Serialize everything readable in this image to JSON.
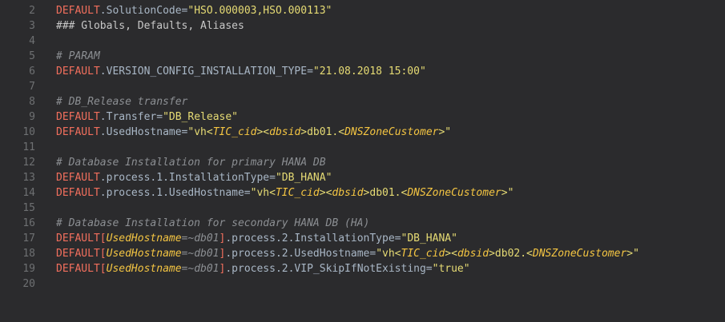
{
  "lines": [
    {
      "n": "2",
      "tokens": [
        {
          "t": "DEFAULT",
          "c": "default"
        },
        {
          "t": ".SolutionCode=",
          "c": "prop"
        },
        {
          "t": "\"HSO.000003,HSO.000113\"",
          "c": "string"
        }
      ]
    },
    {
      "n": "3",
      "tokens": [
        {
          "t": "### Globals, Defaults, Aliases",
          "c": "heading"
        }
      ]
    },
    {
      "n": "4",
      "tokens": []
    },
    {
      "n": "5",
      "tokens": [
        {
          "t": "# PARAM",
          "c": "comment"
        }
      ]
    },
    {
      "n": "6",
      "tokens": [
        {
          "t": "DEFAULT",
          "c": "default"
        },
        {
          "t": ".VERSION_CONFIG_INSTALLATION_TYPE=",
          "c": "prop"
        },
        {
          "t": "\"21.08.2018 15:00\"",
          "c": "string"
        }
      ]
    },
    {
      "n": "7",
      "tokens": []
    },
    {
      "n": "8",
      "tokens": [
        {
          "t": "# DB_Release transfer",
          "c": "comment"
        }
      ]
    },
    {
      "n": "9",
      "tokens": [
        {
          "t": "DEFAULT",
          "c": "default"
        },
        {
          "t": ".Transfer=",
          "c": "prop"
        },
        {
          "t": "\"DB_Release\"",
          "c": "string"
        }
      ]
    },
    {
      "n": "10",
      "tokens": [
        {
          "t": "DEFAULT",
          "c": "default"
        },
        {
          "t": ".UsedHostname=",
          "c": "prop"
        },
        {
          "t": "\"vh<",
          "c": "string"
        },
        {
          "t": "TIC_cid",
          "c": "var"
        },
        {
          "t": "><",
          "c": "string"
        },
        {
          "t": "dbsid",
          "c": "var"
        },
        {
          "t": ">db01.<",
          "c": "string"
        },
        {
          "t": "DNSZoneCustomer",
          "c": "var"
        },
        {
          "t": ">\"",
          "c": "string"
        }
      ]
    },
    {
      "n": "11",
      "tokens": []
    },
    {
      "n": "12",
      "tokens": [
        {
          "t": "# Database Installation for primary HANA DB",
          "c": "comment"
        }
      ]
    },
    {
      "n": "13",
      "tokens": [
        {
          "t": "DEFAULT",
          "c": "default"
        },
        {
          "t": ".process.1.InstallationType=",
          "c": "prop"
        },
        {
          "t": "\"DB_HANA\"",
          "c": "string"
        }
      ]
    },
    {
      "n": "14",
      "tokens": [
        {
          "t": "DEFAULT",
          "c": "default"
        },
        {
          "t": ".process.1.UsedHostname=",
          "c": "prop"
        },
        {
          "t": "\"vh<",
          "c": "string"
        },
        {
          "t": "TIC_cid",
          "c": "var"
        },
        {
          "t": "><",
          "c": "string"
        },
        {
          "t": "dbsid",
          "c": "var"
        },
        {
          "t": ">db01.<",
          "c": "string"
        },
        {
          "t": "DNSZoneCustomer",
          "c": "var"
        },
        {
          "t": ">\"",
          "c": "string"
        }
      ]
    },
    {
      "n": "15",
      "tokens": []
    },
    {
      "n": "16",
      "tokens": [
        {
          "t": "# Database Installation for secondary HANA DB (HA)",
          "c": "comment"
        }
      ]
    },
    {
      "n": "17",
      "tokens": [
        {
          "t": "DEFAULT",
          "c": "default"
        },
        {
          "t": "[",
          "c": "bracket"
        },
        {
          "t": "UsedHostname",
          "c": "var"
        },
        {
          "t": "=~db01",
          "c": "comment"
        },
        {
          "t": "]",
          "c": "bracket"
        },
        {
          "t": ".process.2.InstallationType=",
          "c": "prop"
        },
        {
          "t": "\"DB_HANA\"",
          "c": "string"
        }
      ]
    },
    {
      "n": "18",
      "tokens": [
        {
          "t": "DEFAULT",
          "c": "default"
        },
        {
          "t": "[",
          "c": "bracket"
        },
        {
          "t": "UsedHostname",
          "c": "var"
        },
        {
          "t": "=~db01",
          "c": "comment"
        },
        {
          "t": "]",
          "c": "bracket"
        },
        {
          "t": ".process.2.UsedHostname=",
          "c": "prop"
        },
        {
          "t": "\"vh<",
          "c": "string"
        },
        {
          "t": "TIC_cid",
          "c": "var"
        },
        {
          "t": "><",
          "c": "string"
        },
        {
          "t": "dbsid",
          "c": "var"
        },
        {
          "t": ">db02.<",
          "c": "string"
        },
        {
          "t": "DNSZoneCustomer",
          "c": "var"
        },
        {
          "t": ">\"",
          "c": "string"
        }
      ]
    },
    {
      "n": "19",
      "tokens": [
        {
          "t": "DEFAULT",
          "c": "default"
        },
        {
          "t": "[",
          "c": "bracket"
        },
        {
          "t": "UsedHostname",
          "c": "var"
        },
        {
          "t": "=~db01",
          "c": "comment"
        },
        {
          "t": "]",
          "c": "bracket"
        },
        {
          "t": ".process.2.VIP_SkipIfNotExisting=",
          "c": "prop"
        },
        {
          "t": "\"true\"",
          "c": "string"
        }
      ]
    },
    {
      "n": "20",
      "tokens": []
    }
  ]
}
